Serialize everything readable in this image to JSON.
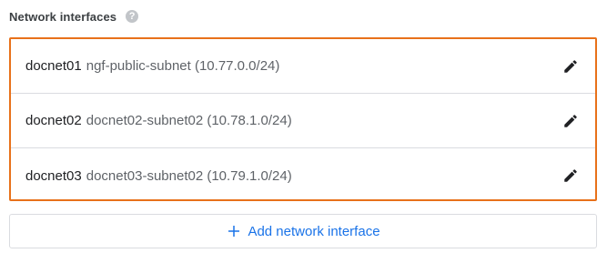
{
  "section": {
    "title": "Network interfaces",
    "help_icon": "help-circle-icon",
    "help_glyph": "?"
  },
  "interfaces": [
    {
      "name": "docnet01",
      "subnet": "ngf-public-subnet (10.77.0.0/24)",
      "edit_icon": "pencil-icon"
    },
    {
      "name": "docnet02",
      "subnet": "docnet02-subnet02 (10.78.1.0/24)",
      "edit_icon": "pencil-icon"
    },
    {
      "name": "docnet03",
      "subnet": "docnet03-subnet02 (10.79.1.0/24)",
      "edit_icon": "pencil-icon"
    }
  ],
  "add_button": {
    "label": "Add network interface",
    "icon": "plus-icon"
  },
  "colors": {
    "highlight_border": "#e8711a",
    "accent_blue": "#1a73e8",
    "icon_dark": "#202124",
    "help_icon_gray": "#c2c5c9",
    "divider": "#dadce0"
  }
}
